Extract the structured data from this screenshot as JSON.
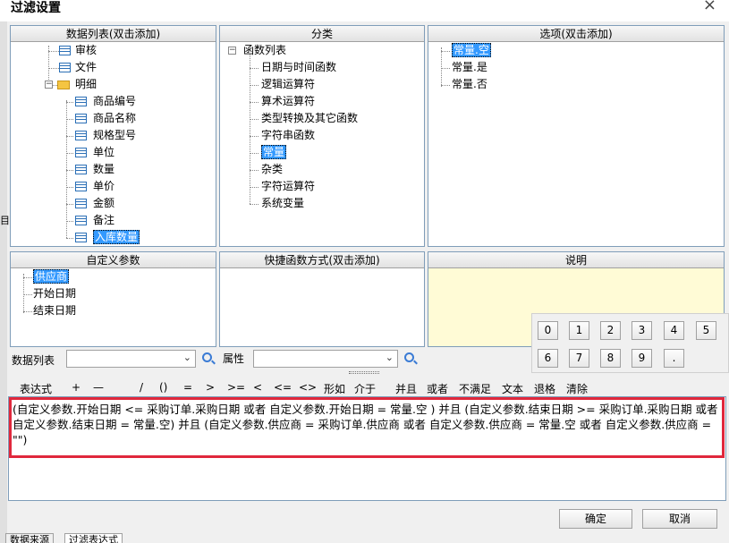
{
  "window": {
    "title": "过滤设置",
    "close_glyph": "×",
    "left_mark": "目"
  },
  "panels": {
    "data_list": {
      "header": "数据列表(双击添加)"
    },
    "category": {
      "header": "分类"
    },
    "options": {
      "header": "选项(双击添加)"
    },
    "custom_params": {
      "header": "自定义参数"
    },
    "shortcut": {
      "header": "快捷函数方式(双击添加)"
    },
    "description": {
      "header": "说明",
      "background": "#fffbd6"
    }
  },
  "data_tree": [
    {
      "label": "审核",
      "icon": "table-icon",
      "level": 1
    },
    {
      "label": "文件",
      "icon": "table-icon",
      "level": 1
    },
    {
      "label": "明细",
      "icon": "folder-icon",
      "level": 1,
      "expanded": true
    },
    {
      "label": "商品编号",
      "icon": "table-icon",
      "level": 2
    },
    {
      "label": "商品名称",
      "icon": "table-icon",
      "level": 2
    },
    {
      "label": "规格型号",
      "icon": "table-icon",
      "level": 2
    },
    {
      "label": "单位",
      "icon": "table-icon",
      "level": 2
    },
    {
      "label": "数量",
      "icon": "table-icon",
      "level": 2
    },
    {
      "label": "单价",
      "icon": "table-icon",
      "level": 2
    },
    {
      "label": "金额",
      "icon": "table-icon",
      "level": 2
    },
    {
      "label": "备注",
      "icon": "table-icon",
      "level": 2
    },
    {
      "label": "入库数量",
      "icon": "table-icon",
      "level": 2,
      "selected": true
    }
  ],
  "category_tree": {
    "root": "函数列表",
    "items": [
      "日期与时间函数",
      "逻辑运算符",
      "算术运算符",
      "类型转换及其它函数",
      "字符串函数",
      "常量",
      "杂类",
      "字符运算符",
      "系统变量"
    ],
    "selected_index": 5
  },
  "options_list": {
    "items": [
      "常量.空",
      "常量.是",
      "常量.否"
    ],
    "selected_index": 0
  },
  "custom_params_list": {
    "items": [
      "供应商",
      "开始日期",
      "结束日期"
    ],
    "selected_index": 0
  },
  "filters": {
    "data_list_label": "数据列表",
    "data_list_value": "",
    "attribute_label": "属性",
    "attribute_value": ""
  },
  "keypad": {
    "keys": [
      "0",
      "1",
      "2",
      "3",
      "4",
      "5",
      "6",
      "7",
      "8",
      "9",
      "."
    ]
  },
  "operators": [
    "表达式",
    "+",
    "—",
    "/",
    "()",
    "=",
    ">",
    ">=",
    "<",
    "<=",
    "<>",
    "形如",
    "介于",
    "并且",
    "或者",
    "不满足",
    "文本",
    "退格",
    "清除"
  ],
  "expression": "(自定义参数.开始日期 <= 采购订单.采购日期 或者 自定义参数.开始日期 = 常量.空 ) 并且 (自定义参数.结束日期 >= 采购订单.采购日期 或者 自定义参数.结束日期 = 常量.空) 并且 (自定义参数.供应商 = 采购订单.供应商 或者 自定义参数.供应商 = 常量.空 或者 自定义参数.供应商 = \"\")",
  "buttons": {
    "ok": "确定",
    "cancel": "取消"
  },
  "bottom_tabs": [
    "数据来源",
    "过滤表达式"
  ],
  "colors": {
    "selection": "#3399ff",
    "highlight_border": "#e0283c"
  }
}
